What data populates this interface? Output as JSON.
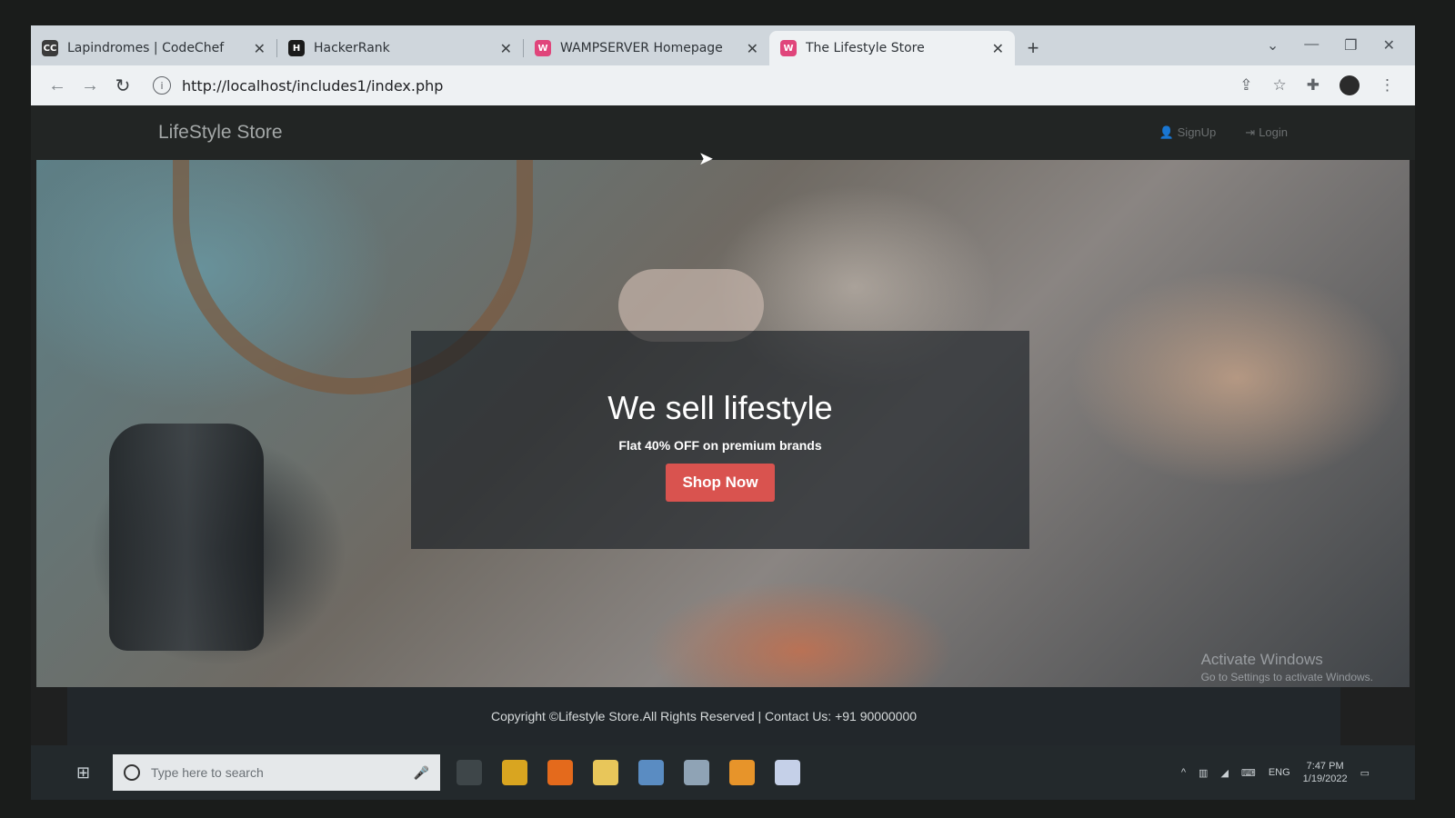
{
  "browser": {
    "tabs": [
      {
        "title": "Lapindromes | CodeChef",
        "favicon": "CC",
        "favicon_color": "#3b3b3b",
        "active": false
      },
      {
        "title": "HackerRank",
        "favicon": "H",
        "favicon_color": "#1a1a1a",
        "active": false
      },
      {
        "title": "WAMPSERVER Homepage",
        "favicon": "W",
        "favicon_color": "#e0457b",
        "active": false
      },
      {
        "title": "The Lifestyle Store",
        "favicon": "W",
        "favicon_color": "#e0457b",
        "active": true
      }
    ],
    "url": "http://localhost/includes1/index.php"
  },
  "site": {
    "brand": "LifeStyle Store",
    "nav": {
      "signup": "SignUp",
      "login": "Login"
    },
    "hero": {
      "title": "We sell lifestyle",
      "subtitle": "Flat 40% OFF on premium brands",
      "cta": "Shop Now"
    },
    "footer": "Copyright ©Lifestyle Store.All Rights Reserved | Contact Us: +91 90000000"
  },
  "watermark": {
    "title": "Activate Windows",
    "subtitle": "Go to Settings to activate Windows."
  },
  "taskbar": {
    "search_placeholder": "Type here to search",
    "lang": "ENG",
    "time": "7:47 PM",
    "date": "1/19/2022"
  },
  "colors": {
    "cta": "#d9534f",
    "footer_bg": "#22272b",
    "nav_bg": "#222524"
  }
}
